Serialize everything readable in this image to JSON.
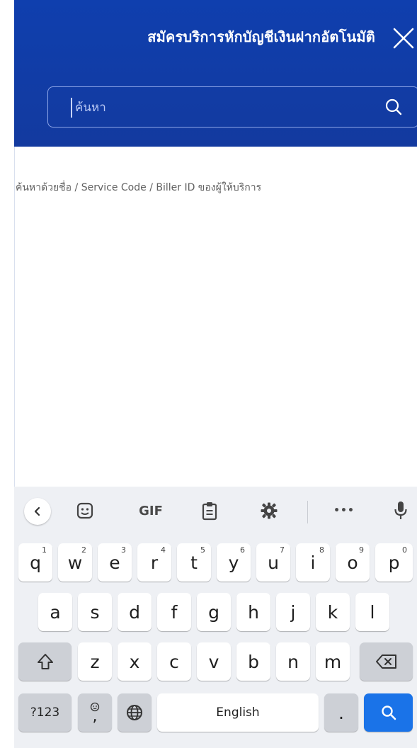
{
  "header": {
    "title": "สมัครบริการหักบัญชีเงินฝากอัตโนมัติ",
    "search_placeholder": "ค้นหา"
  },
  "content": {
    "hint": "ค้นหาด้วยชื่อ / Service Code / Biller ID ของผู้ให้บริการ"
  },
  "keyboard": {
    "toolbar": {
      "back_icon": "chevron-left-icon",
      "sticker_icon": "sticker-icon",
      "gif_label": "GIF",
      "clipboard_icon": "clipboard-icon",
      "settings_icon": "gear-icon",
      "more_label": "•••",
      "mic_icon": "microphone-icon"
    },
    "row1": [
      {
        "k": "q",
        "n": "1"
      },
      {
        "k": "w",
        "n": "2"
      },
      {
        "k": "e",
        "n": "3"
      },
      {
        "k": "r",
        "n": "4"
      },
      {
        "k": "t",
        "n": "5"
      },
      {
        "k": "y",
        "n": "6"
      },
      {
        "k": "u",
        "n": "7"
      },
      {
        "k": "i",
        "n": "8"
      },
      {
        "k": "o",
        "n": "9"
      },
      {
        "k": "p",
        "n": "0"
      }
    ],
    "row2": [
      "a",
      "s",
      "d",
      "f",
      "g",
      "h",
      "j",
      "k",
      "l"
    ],
    "row3": [
      "z",
      "x",
      "c",
      "v",
      "b",
      "n",
      "m"
    ],
    "sym_label": "?123",
    "comma_label": ",",
    "space_label": "English",
    "period_label": "."
  },
  "colors": {
    "header_bg": "#0f3fae",
    "accent": "#1a73e8"
  }
}
